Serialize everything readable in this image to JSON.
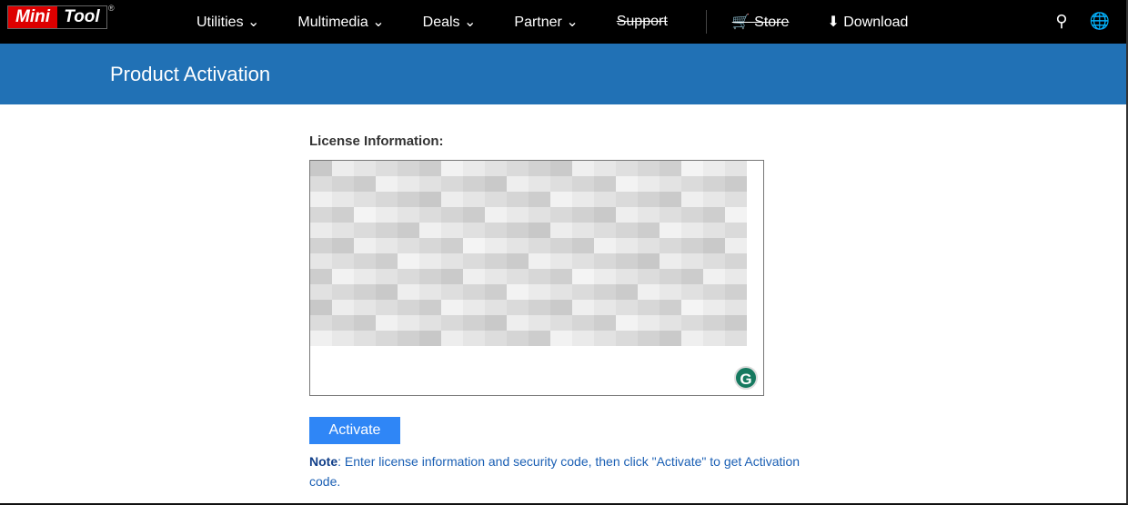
{
  "nav": {
    "logo_left": "Mini",
    "logo_right": "Tool",
    "logo_reg": "®",
    "items": [
      {
        "label": "Utilities ⌄"
      },
      {
        "label": "Multimedia ⌄"
      },
      {
        "label": "Deals ⌄"
      },
      {
        "label": "Partner ⌄"
      },
      {
        "label": "Support"
      }
    ],
    "store": "🛒 Store",
    "download": "⬇ Download",
    "search_icon": "⚲",
    "globe_icon": "🌐"
  },
  "banner": {
    "title": "Product Activation"
  },
  "form": {
    "label": "License Information:",
    "grammarly": "G",
    "activate": "Activate",
    "note_label": "Note",
    "note_text": ": Enter license information and security code, then click \"Activate\" to get Activation code."
  }
}
